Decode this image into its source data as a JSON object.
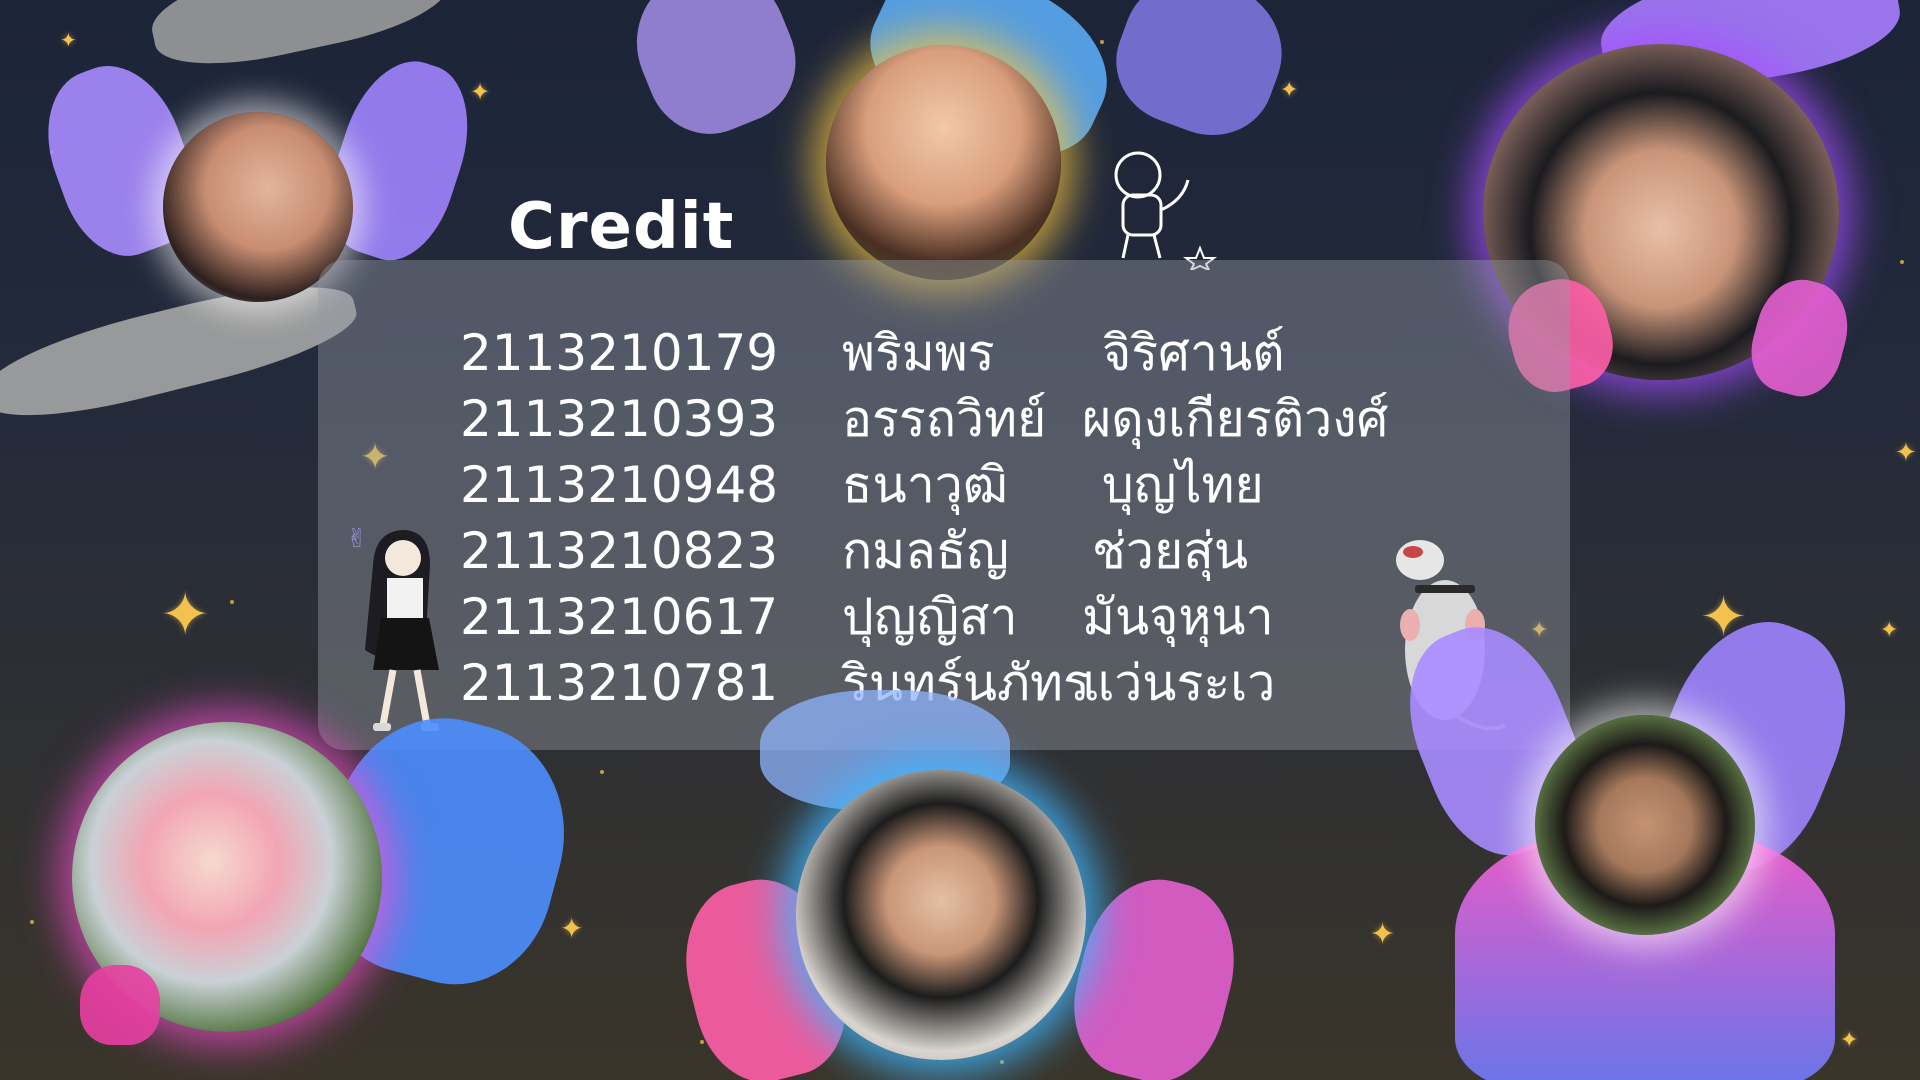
{
  "title": "Credit",
  "credits": [
    {
      "id": "2113210179",
      "first_name": "พริมพร",
      "last_name": "จิริศานต์"
    },
    {
      "id": "2113210393",
      "first_name": "อรรถวิทย์",
      "last_name": "ผดุงเกียรติวงศ์"
    },
    {
      "id": "2113210948",
      "first_name": "ธนาวุฒิ",
      "last_name": "บุญไทย"
    },
    {
      "id": "2113210823",
      "first_name": "กมลธัญ",
      "last_name": "ช่วยสุ่น"
    },
    {
      "id": "2113210617",
      "first_name": "ปุญญิสา",
      "last_name": "มันจุหุนา"
    },
    {
      "id": "2113210781",
      "first_name": "รินทร์นภัทร",
      "last_name": "แว่นระเว"
    }
  ],
  "colors": {
    "background_top": "#1c2438",
    "background_bottom": "#3a352a",
    "sparkle": "#f2c14e",
    "panel": "#969ba5",
    "glow_gold": "#f5c542",
    "glow_purple": "#a64dff",
    "glow_blue": "#3fb6ff",
    "glow_pink": "#ff4fd8",
    "hand_purple": "#a88cff",
    "hand_blue": "#5a9cff",
    "hand_pink": "#ff5fa8"
  },
  "decorations": {
    "sparkle_icon": "four-point-star-icon",
    "stickers": [
      "astronaut-sketch-icon",
      "anime-girl-icon",
      "white-rat-icon"
    ]
  }
}
